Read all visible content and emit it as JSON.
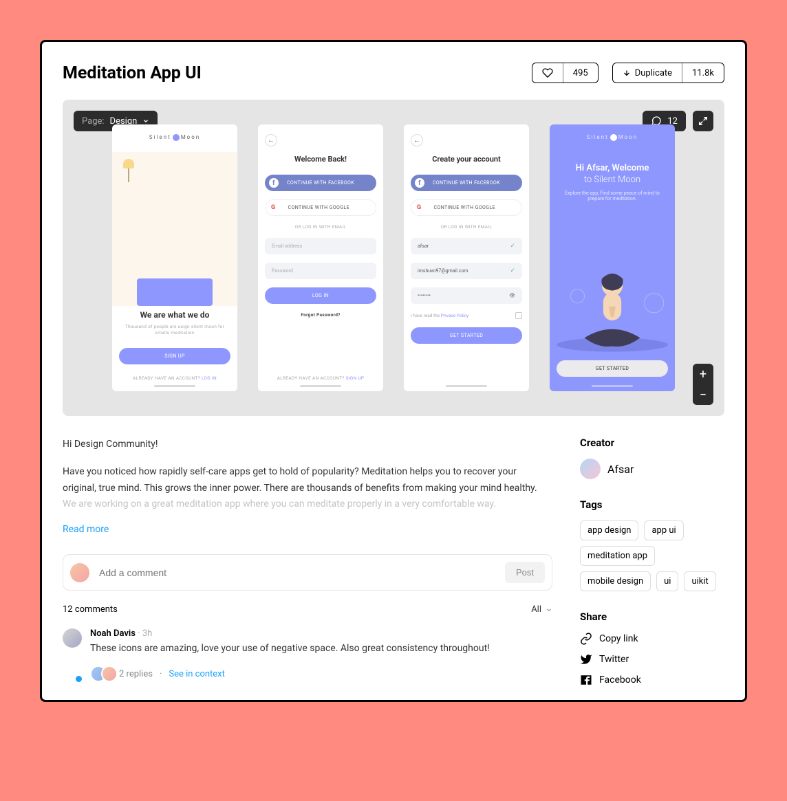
{
  "header": {
    "title": "Meditation App UI",
    "likes": "495",
    "duplicate_label": "Duplicate",
    "duplicate_count": "11.8k"
  },
  "canvas": {
    "page_label_prefix": "Page:",
    "page_name": "Design",
    "comment_count": "12",
    "screens": {
      "brand_left": "Silent",
      "brand_right": "Moon",
      "s1": {
        "headline": "We are what we do",
        "sub": "Thousand of people are usign silent moon for smalls meditation",
        "signup": "SIGN UP",
        "already": "ALREADY HAVE AN ACCOUNT?",
        "login": "LOG IN"
      },
      "s2": {
        "title": "Welcome Back!",
        "fb": "CONTINUE WITH FACEBOOK",
        "gg": "CONTINUE WITH GOOGLE",
        "or": "OR LOG IN WITH EMAIL",
        "email_ph": "Email address",
        "pass_ph": "Password",
        "login": "LOG IN",
        "forgot": "Forgot Password?",
        "already": "ALREADY HAVE AN ACCOUNT?",
        "signup": "SIGN UP"
      },
      "s3": {
        "title": "Create your account",
        "fb": "CONTINUE WITH FACEBOOK",
        "gg": "CONTINUE WITH GOOGLE",
        "or": "OR LOG IN WITH EMAIL",
        "name_val": "afsar",
        "email_val": "imshuvo97@gmail.com",
        "pass_val": "••••••••",
        "policy_pre": "I have read the",
        "policy_link": "Privace Policy",
        "cta": "GET STARTED"
      },
      "s4": {
        "hi": "Hi Afsar, Welcome",
        "to": "to Silent Moon",
        "sub": "Explore the app, Find some peace of mind to prepare for meditation.",
        "cta": "GET STARTED"
      }
    }
  },
  "description": {
    "greeting": "Hi Design Community!",
    "para": "Have you noticed how rapidly self-care apps get to hold of popularity? Meditation helps you to recover your original, true mind. This grows the inner power. There are thousands of benefits from making your mind healthy. ",
    "fade": "We are working on a great meditation app where you can meditate properly in a very comfortable way.",
    "read_more": "Read more"
  },
  "comments": {
    "input_placeholder": "Add a comment",
    "post_label": "Post",
    "count_label": "12 comments",
    "filter_label": "All",
    "c1": {
      "name": "Noah Davis",
      "time": "3h",
      "text": "These icons are amazing, love your use of negative space. Also great consistency throughout!",
      "replies": "2 replies",
      "see": "See in context"
    }
  },
  "sidebar": {
    "creator_heading": "Creator",
    "creator_name": "Afsar",
    "tags_heading": "Tags",
    "tags": [
      "app design",
      "app ui",
      "meditation app",
      "mobile design",
      "ui",
      "uikit"
    ],
    "share_heading": "Share",
    "share": {
      "copy": "Copy link",
      "twitter": "Twitter",
      "facebook": "Facebook"
    }
  }
}
